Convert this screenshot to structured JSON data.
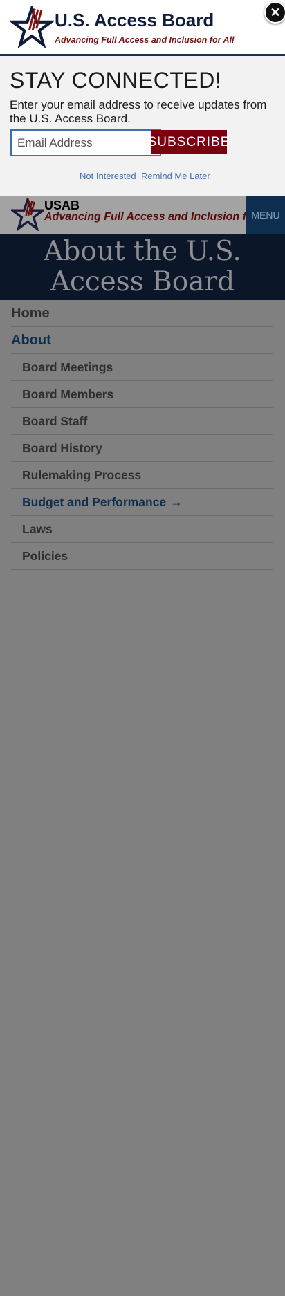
{
  "modal": {
    "logo_icon": "star-logo-icon",
    "title": "U.S. Access Board",
    "tagline": "Advancing Full Access and Inclusion for All",
    "close_icon": "close-icon",
    "heading": "STAY CONNECTED!",
    "description": "Enter your email address to receive updates from the U.S. Access Board.",
    "email_placeholder": "Email Address",
    "subscribe_label": "SUBSCRIBE",
    "not_interested": "Not Interested",
    "remind_later": "Remind Me Later"
  },
  "header": {
    "logo_icon": "star-logo-icon",
    "short_name": "USAB",
    "tagline": "Advancing Full Access and Inclusion for All",
    "menu_label": "MENU"
  },
  "hero": {
    "title": "About the U.S. Access Board"
  },
  "nav": {
    "items": [
      {
        "label": "Home"
      },
      {
        "label": "About"
      }
    ],
    "sub_items": [
      {
        "label": "Board Meetings"
      },
      {
        "label": "Board Members"
      },
      {
        "label": "Board Staff"
      },
      {
        "label": "Board History"
      },
      {
        "label": "Rulemaking Process"
      },
      {
        "label": "Budget and Performance",
        "arrow": "→"
      },
      {
        "label": "Laws"
      },
      {
        "label": "Policies"
      }
    ]
  },
  "colors": {
    "navy": "#0f1c3a",
    "maroon": "#7a0010",
    "link_blue": "#3f6fb5",
    "overlay_gray": "#808080"
  }
}
